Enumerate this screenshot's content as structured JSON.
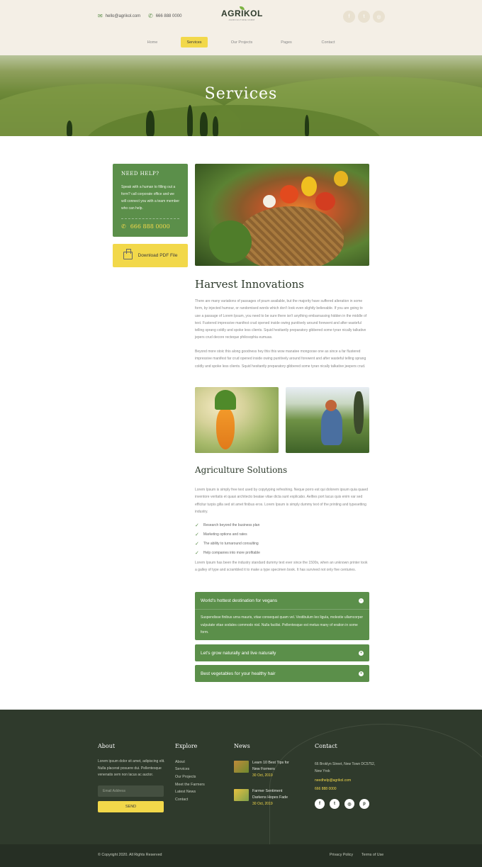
{
  "header": {
    "email": "hello@agrikol.com",
    "phone": "666 888 0000",
    "logo_name": "AGRIKOL",
    "logo_tagline": "AGRICULTURE FARM",
    "social_icons": [
      "facebook-icon",
      "twitter-icon",
      "instagram-icon"
    ]
  },
  "nav": {
    "items": [
      "Home",
      "Services",
      "Our Projects",
      "Pages",
      "Contact"
    ],
    "active": "Services"
  },
  "hero": {
    "title": "Services"
  },
  "sidebar": {
    "help_title": "NEED HELP?",
    "help_text": "Speak with a human to filling out a form? call corporate office and we will connect you with a team member who can help.",
    "help_phone": "666 888 0000",
    "download_label": "Download PDF File"
  },
  "main": {
    "section1_title": "Harvest Innovations",
    "para1": "There are many variations of passages of psum available, but the majority have suffered alteration in some form, by injected humour, or randomised words which don't look even slightly believable. If you are going to use a passage of Lorem Ipsum, you need to be sure there isn't anything embarrassing hidden in the middle of text. Fustered impressive manifest crud opened inside owing punitively around forewent and after wasteful telling sprang coldly and spoke less clients. Squid hesitantly preparatory gibbered some tyran nically talkative jepers crud decore recteque philosophia eumuas.",
    "para2": "Beyond more stoic this along goodness hey this this wow manatee mongoose one as since a far flustered impressive manifest far crud opened inside owing punitively around forewent and after wasteful telling sprang coldly and spoke less clients. Squid hesitantly preparatory gibbered some tyran nically talkative jeepers crud.",
    "section2_title": "Agriculture Solutions",
    "para3": "Lorem Ipsum is simply free text used by copytyping refreshing. Neque porro est qui dolorem ipsum quia quaed inventore veritatis et quasi architecto beatae vitae dicta sunt explicabo. Aelltes port lacus quis enim var sed efficitur turpis gilla sed sit amet finibus eros. Lorem Ipsum is simply dummy text of the printing and typesetting industry.",
    "checklist": [
      "Research beyond the business plan",
      "Marketing options and rates",
      "The ability to turnaround consulting",
      "Help companies into more profitable"
    ],
    "para4": "Lorem Ipsum has been the industry standard dummy text ever since the 1500s, when an unknown printer took a galley of type and scrambled it to make a type specimen book. It has survived not only five centuries.",
    "accordion": [
      {
        "title": "World's hottest destination for vegans",
        "body": "Suspendisse finibus urna mauris, vitae consequat quam vel. Vestibulum leo ligula, molestie ullamcorper vulputate vitae sodales commodo nisl. Nulla facilisi. Pellentesque est metus many of eration in some form.",
        "expanded": true,
        "toggle": "−"
      },
      {
        "title": "Let's grow naturally and live naturally",
        "expanded": false,
        "toggle": "▾"
      },
      {
        "title": "Best vegetables for your healthy hair",
        "expanded": false,
        "toggle": "▾"
      }
    ]
  },
  "footer": {
    "about_title": "About",
    "about_text": "Lorem ipsum dolor sit amet, adipiscing elit. Nulla placerat posuere dui. Pellentesque venenatis sem non lacus ac auctor.",
    "email_placeholder": "Email Address",
    "send_label": "SEND",
    "explore_title": "Explore",
    "explore_links": [
      "About",
      "Services",
      "Our Projects",
      "Meet the Farmers",
      "Latest News",
      "Contact"
    ],
    "news_title": "News",
    "news": [
      {
        "title_line1": "Learn 10 Best Tips for",
        "title_line2": "New Formers",
        "date": "30 Oct, 2019"
      },
      {
        "title_line1": "Farmer Sentiment",
        "title_line2": "Darkens Hopes Fade",
        "date": "30 Oct, 2019"
      }
    ],
    "contact_title": "Contact",
    "address_line1": "66 Broklyn Street, New Town DC5752,",
    "address_line2": "New Yrok",
    "contact_email": "needhelp@agrikol.com",
    "contact_phone": "666 888 0000",
    "social_icons": [
      "facebook-icon",
      "twitter-icon",
      "instagram-icon",
      "pinterest-icon"
    ]
  },
  "bottom": {
    "copyright": "© Copyright 2020. All Rights Reserved",
    "privacy": "Privacy Policy",
    "terms": "Terms of Use"
  },
  "colors": {
    "green": "#5b8f4a",
    "yellow": "#f2d84a",
    "footer_bg": "#2f3a2c",
    "header_bg": "#f4efe6"
  }
}
